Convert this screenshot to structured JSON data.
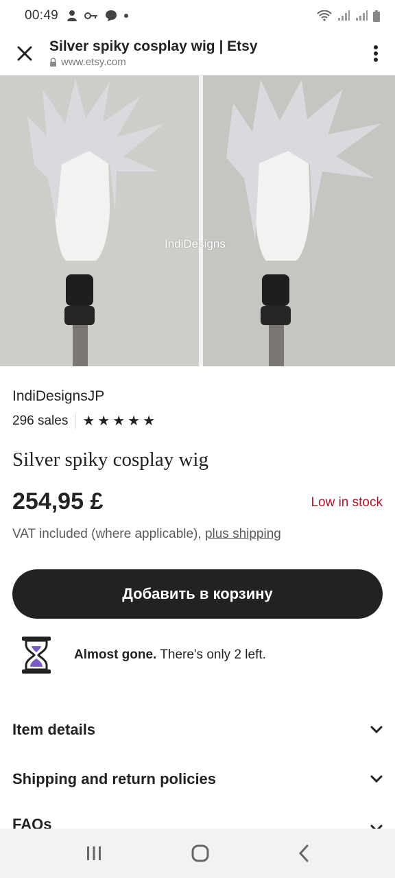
{
  "status_bar": {
    "time": "00:49"
  },
  "browser": {
    "page_title": "Silver spiky cosplay wig | Etsy",
    "url": "www.etsy.com"
  },
  "photo": {
    "watermark": "IndiDesigns"
  },
  "listing": {
    "shop_name": "IndiDesignsJP",
    "sales": "296 sales",
    "rating_stars": 5,
    "title": "Silver spiky cosplay wig",
    "price": "254,95 £",
    "stock_status": "Low in stock",
    "vat_text": "VAT included (where applicable), ",
    "shipping_link": "plus shipping",
    "add_to_cart": "Добавить в корзину",
    "almost_gone_bold": "Almost gone.",
    "almost_gone_rest": " There's only 2 left."
  },
  "sections": [
    {
      "label": "Item details"
    },
    {
      "label": "Shipping and return policies"
    },
    {
      "label": "FAQs"
    }
  ],
  "colors": {
    "accent_stock": "#a61a2e",
    "button_bg": "#222222",
    "hourglass_purple": "#7b5bc4"
  },
  "icons": [
    "close-icon",
    "lock-icon",
    "more-vert-icon",
    "star-icon",
    "hourglass-icon",
    "chevron-down-icon",
    "recents-icon",
    "home-icon",
    "back-icon"
  ]
}
